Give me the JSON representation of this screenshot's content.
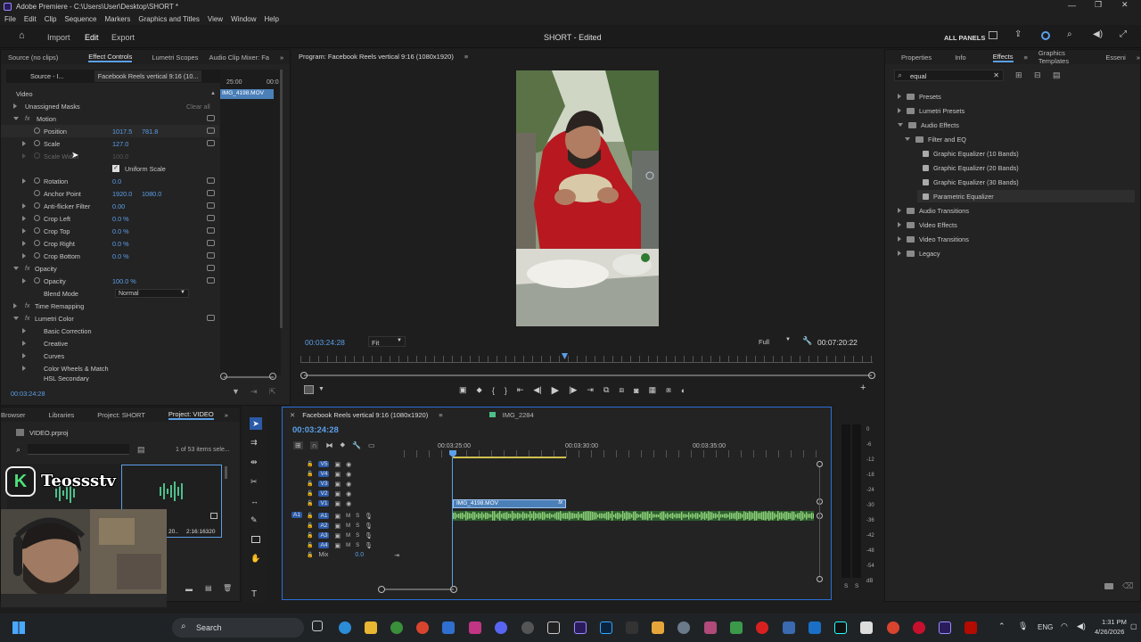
{
  "titlebar": {
    "title": "Adobe Premiere - C:\\Users\\User\\Desktop\\SHORT *"
  },
  "menu": [
    "File",
    "Edit",
    "Clip",
    "Sequence",
    "Markers",
    "Graphics and Titles",
    "View",
    "Window",
    "Help"
  ],
  "appbar": {
    "import": "Import",
    "edit": "Edit",
    "export": "Export",
    "project_title": "SHORT - Edited",
    "all_panels": "ALL PANELS"
  },
  "left_tabs": {
    "source": "Source (no clips)",
    "effect_controls": "Effect Controls",
    "lumetri": "Lumetri Scopes",
    "audio_mixer": "Audio Clip Mixer: Fa"
  },
  "ec": {
    "source": "Source - I...",
    "sequence": "Facebook Reels vertical 9:16 (10...",
    "ruler_time": "25:00",
    "ruler_time2": "00:0",
    "clip": "IMG_4198.MOV",
    "video": "Video",
    "masks": "Unassigned Masks",
    "clear": "Clear all",
    "motion": "Motion",
    "position": "Position",
    "pos_x": "1017.5",
    "pos_y": "781.8",
    "scale": "Scale",
    "scale_v": "127.0",
    "scale_w": "Scale Width",
    "scale_w_v": "100.0",
    "uniform": "Uniform Scale",
    "rotation": "Rotation",
    "rotation_v": "0.0",
    "anchor": "Anchor Point",
    "anchor_x": "1920.0",
    "anchor_y": "1080.0",
    "flicker": "Anti-flicker Filter",
    "flicker_v": "0.00",
    "crop_left": "Crop Left",
    "crop_top": "Crop Top",
    "crop_right": "Crop Right",
    "crop_bottom": "Crop Bottom",
    "crop_v": "0.0 %",
    "opacity_hdr": "Opacity",
    "opacity": "Opacity",
    "opacity_v": "100.0 %",
    "blend": "Blend Mode",
    "blend_v": "Normal",
    "time_remap": "Time Remapping",
    "lumetri": "Lumetri Color",
    "basic": "Basic Correction",
    "creative": "Creative",
    "curves": "Curves",
    "color_wheels": "Color Wheels & Match",
    "hsl": "HSL Secondary",
    "timecode": "00:03:24:28"
  },
  "program": {
    "title": "Program: Facebook Reels vertical 9:16 (1080x1920)",
    "timecode": "00:03:24:28",
    "fit": "Fit",
    "full": "Full",
    "duration": "00:07:20:22"
  },
  "right_tabs": {
    "properties": "Properties",
    "info": "Info",
    "effects": "Effects",
    "graphics": "Graphics Templates",
    "essential": "Esseni"
  },
  "effects": {
    "search": "equal",
    "presets": "Presets",
    "lumetri_presets": "Lumetri Presets",
    "audio_effects": "Audio Effects",
    "filter_eq": "Filter and EQ",
    "geq10": "Graphic Equalizer (10 Bands)",
    "geq20": "Graphic Equalizer (20 Bands)",
    "geq30": "Graphic Equalizer (30 Bands)",
    "param": "Parametric Equalizer",
    "audio_trans": "Audio Transitions",
    "video_effects": "Video Effects",
    "video_trans": "Video Transitions",
    "legacy": "Legacy"
  },
  "project": {
    "browser": "Browser",
    "libraries": "Libraries",
    "proj_short": "Project: SHORT",
    "proj_video": "Project: VIDEO",
    "file": "VIDEO.prproj",
    "items": "1 of 53 items sele...",
    "clip_dur_a": "20..",
    "clip_dur_b": "2:16:16320",
    "brand": "Teossstv"
  },
  "timeline": {
    "tab1": "Facebook Reels vertical 9:16 (1080x1920)",
    "tab2": "IMG_2284",
    "timecode": "00:03:24:28",
    "t1": "00:03:25:00",
    "t2": "00:03:30:00",
    "t3": "00:03:35:00",
    "tracks_v": [
      "V5",
      "V4",
      "V3",
      "V2",
      "V1"
    ],
    "tracks_a": [
      "A1",
      "A2",
      "A3",
      "A4"
    ],
    "mix": "Mix",
    "mix_v": "0.0",
    "src_a1": "A1",
    "clip": "IMG_4198.MOV"
  },
  "meter": {
    "ticks": [
      "0",
      "-6",
      "-12",
      "-18",
      "-24",
      "-30",
      "-36",
      "-42",
      "-48",
      "-54",
      "dB"
    ],
    "s": "S",
    "s2": "S"
  },
  "taskbar": {
    "search": "Search",
    "lang": "ENG",
    "time": "1:31 PM",
    "date": "4/26/2026"
  },
  "colors": {
    "accent": "#5b9fe8",
    "panel": "#232323",
    "clip_video": "#4b7fb8",
    "clip_audio": "#3f7a3f",
    "waveform": "#8ed07a"
  }
}
